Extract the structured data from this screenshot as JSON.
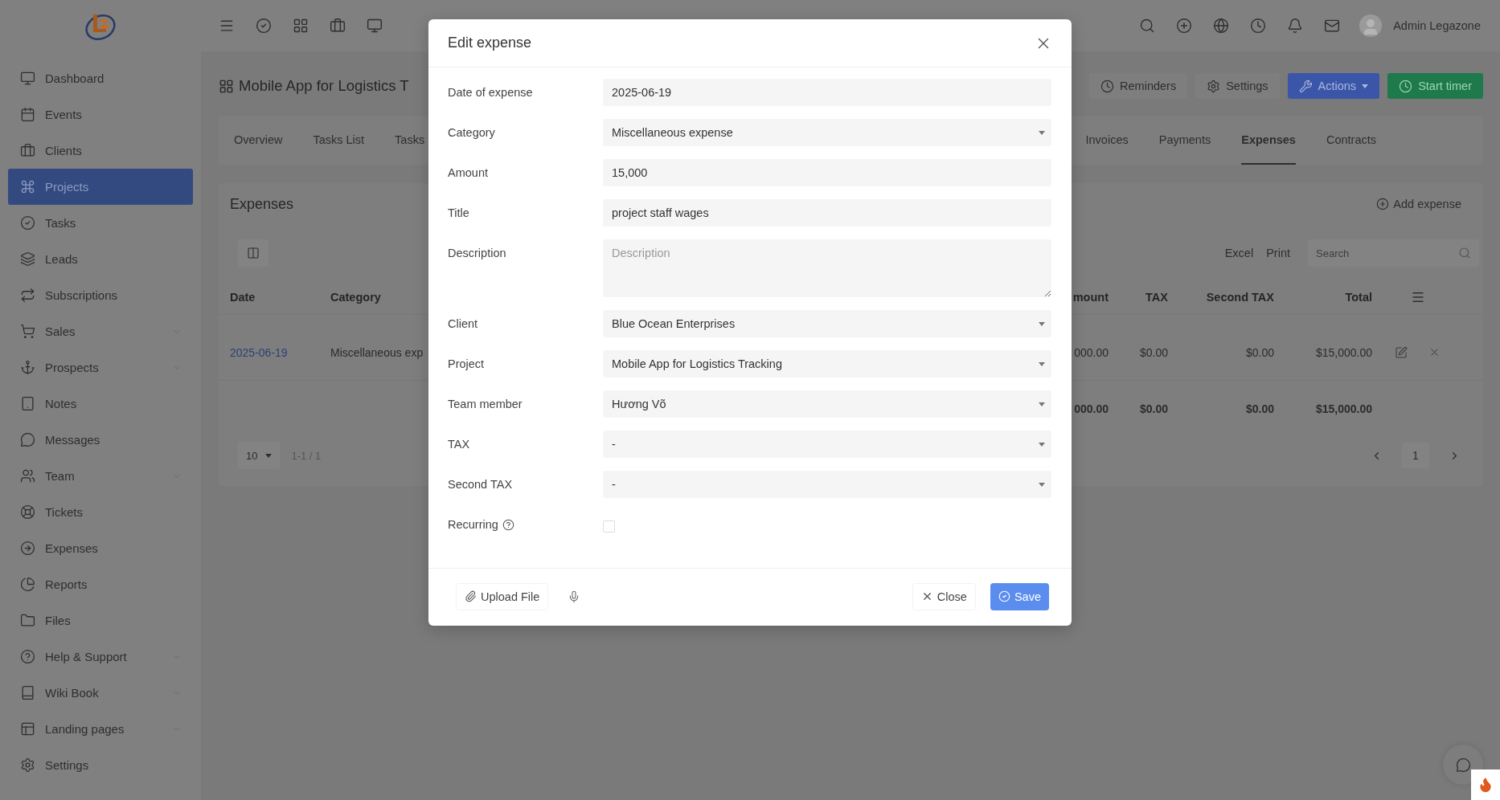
{
  "topbar": {
    "user_name": "Admin Legazone"
  },
  "sidebar": {
    "items": [
      {
        "label": "Dashboard",
        "selected": false,
        "has_submenu": false
      },
      {
        "label": "Events",
        "selected": false,
        "has_submenu": false
      },
      {
        "label": "Clients",
        "selected": false,
        "has_submenu": false
      },
      {
        "label": "Projects",
        "selected": true,
        "has_submenu": false
      },
      {
        "label": "Tasks",
        "selected": false,
        "has_submenu": false
      },
      {
        "label": "Leads",
        "selected": false,
        "has_submenu": false
      },
      {
        "label": "Subscriptions",
        "selected": false,
        "has_submenu": false
      },
      {
        "label": "Sales",
        "selected": false,
        "has_submenu": true
      },
      {
        "label": "Prospects",
        "selected": false,
        "has_submenu": true
      },
      {
        "label": "Notes",
        "selected": false,
        "has_submenu": false
      },
      {
        "label": "Messages",
        "selected": false,
        "has_submenu": false
      },
      {
        "label": "Team",
        "selected": false,
        "has_submenu": true
      },
      {
        "label": "Tickets",
        "selected": false,
        "has_submenu": false
      },
      {
        "label": "Expenses",
        "selected": false,
        "has_submenu": false
      },
      {
        "label": "Reports",
        "selected": false,
        "has_submenu": false
      },
      {
        "label": "Files",
        "selected": false,
        "has_submenu": false
      },
      {
        "label": "Help & Support",
        "selected": false,
        "has_submenu": true
      },
      {
        "label": "Wiki Book",
        "selected": false,
        "has_submenu": true
      },
      {
        "label": "Landing pages",
        "selected": false,
        "has_submenu": true
      },
      {
        "label": "Settings",
        "selected": false,
        "has_submenu": false
      }
    ]
  },
  "page": {
    "title": "Mobile App for Logistics T",
    "buttons": [
      {
        "label": "Reminders",
        "kind": "plain",
        "dropdown": false
      },
      {
        "label": "Settings",
        "kind": "plain",
        "dropdown": false
      },
      {
        "label": "Actions",
        "kind": "primary",
        "dropdown": true
      },
      {
        "label": "Start timer",
        "kind": "success",
        "dropdown": false
      }
    ]
  },
  "tabs": {
    "left": [
      {
        "label": "Overview",
        "selected": false
      },
      {
        "label": "Tasks List",
        "selected": false
      },
      {
        "label": "Tasks",
        "selected": false
      }
    ],
    "right": [
      {
        "label": "Invoices",
        "selected": false
      },
      {
        "label": "Payments",
        "selected": false
      },
      {
        "label": "Expenses",
        "selected": true
      },
      {
        "label": "Contracts",
        "selected": false
      }
    ]
  },
  "expenses": {
    "title": "Expenses",
    "add_label": "Add expense",
    "export_buttons": [
      "Excel",
      "Print"
    ],
    "search_placeholder": "Search",
    "columns": [
      "Date",
      "Category",
      "mount",
      "TAX",
      "Second TAX",
      "Total"
    ],
    "rows": [
      {
        "cells": [
          "2025-06-19",
          "Miscellaneous exp",
          "000.00",
          "$0.00",
          "$0.00",
          "$15,000.00"
        ]
      }
    ],
    "totals": [
      "000.00",
      "$0.00",
      "$0.00",
      "$15,000.00"
    ],
    "page_size": "10",
    "range": "1-1 / 1",
    "current_page": "1"
  },
  "modal": {
    "title": "Edit expense",
    "fields": [
      {
        "label": "Date of expense",
        "kind": "text",
        "value": "2025-06-19"
      },
      {
        "label": "Category",
        "kind": "select",
        "value": "Miscellaneous expense"
      },
      {
        "label": "Amount",
        "kind": "text",
        "value": "15,000"
      },
      {
        "label": "Title",
        "kind": "text",
        "value": "project staff wages"
      },
      {
        "label": "Description",
        "kind": "textarea",
        "placeholder": "Description"
      },
      {
        "label": "Client",
        "kind": "select",
        "value": "Blue Ocean Enterprises"
      },
      {
        "label": "Project",
        "kind": "select",
        "value": "Mobile App for Logistics Tracking"
      },
      {
        "label": "Team member",
        "kind": "select",
        "value": "Hương Võ"
      },
      {
        "label": "TAX",
        "kind": "select",
        "value": "-"
      },
      {
        "label": "Second TAX",
        "kind": "select",
        "value": "-"
      },
      {
        "label": "Recurring",
        "kind": "checkbox",
        "checked": false,
        "help": true
      }
    ],
    "upload_label": "Upload File",
    "close_label": "Close",
    "save_label": "Save"
  }
}
